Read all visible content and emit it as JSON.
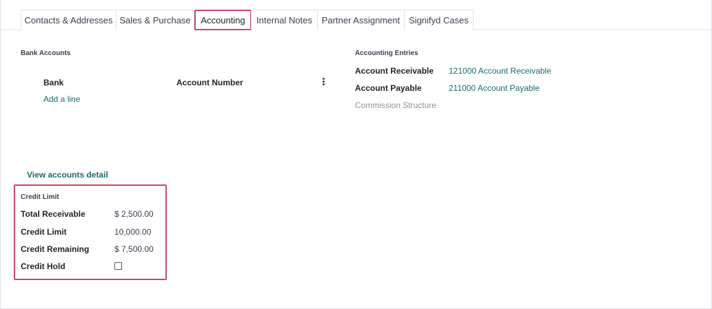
{
  "tabs": [
    {
      "label": "Contacts & Addresses"
    },
    {
      "label": "Sales & Purchase"
    },
    {
      "label": "Accounting",
      "active": true
    },
    {
      "label": "Internal Notes"
    },
    {
      "label": "Partner Assignment"
    },
    {
      "label": "Signifyd Cases"
    }
  ],
  "bank_accounts": {
    "title": "Bank Accounts",
    "columns": [
      "Bank",
      "Account Number"
    ],
    "add_line": "Add a line"
  },
  "accounting_entries": {
    "title": "Accounting Entries",
    "receivable_label": "Account Receivable",
    "receivable_value": "121000 Account Receivable",
    "payable_label": "Account Payable",
    "payable_value": "211000 Account Payable",
    "commission_label": "Commission Structure"
  },
  "view_accounts_detail": "View accounts detail",
  "credit_limit": {
    "title": "Credit Limit",
    "total_receivable_label": "Total Receivable",
    "total_receivable_value": "$ 2,500.00",
    "credit_limit_label": "Credit Limit",
    "credit_limit_value": "10,000.00",
    "credit_remaining_label": "Credit Remaining",
    "credit_remaining_value": "$ 7,500.00",
    "credit_hold_label": "Credit Hold",
    "credit_hold_checked": false
  },
  "colors": {
    "accent_link": "#1f6a6a",
    "highlight": "#c9486a"
  }
}
